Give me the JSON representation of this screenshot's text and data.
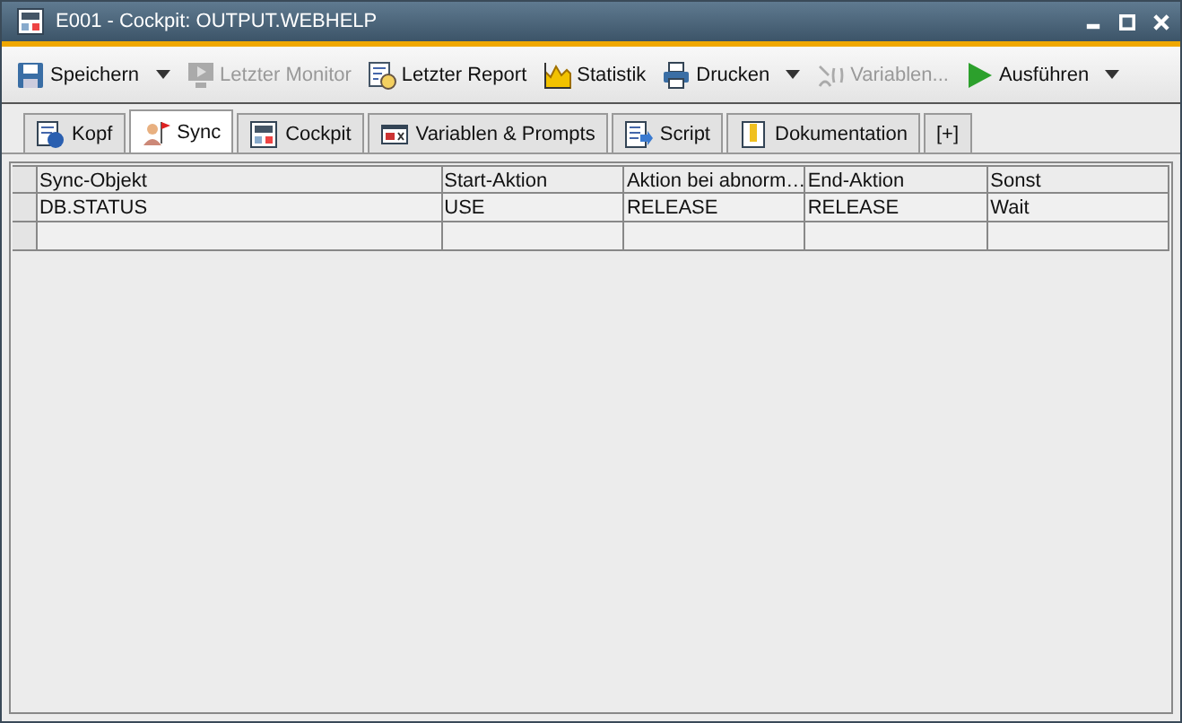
{
  "window": {
    "title": "E001 - Cockpit: OUTPUT.WEBHELP"
  },
  "toolbar": [
    {
      "label": "Speichern",
      "disabled": false,
      "dropdown": true
    },
    {
      "label": "Letzter Monitor",
      "disabled": true,
      "dropdown": false
    },
    {
      "label": "Letzter Report",
      "disabled": false,
      "dropdown": false
    },
    {
      "label": "Statistik",
      "disabled": false,
      "dropdown": false
    },
    {
      "label": "Drucken",
      "disabled": false,
      "dropdown": true
    },
    {
      "label": "Variablen...",
      "disabled": true,
      "dropdown": false
    },
    {
      "label": "Ausführen",
      "disabled": false,
      "dropdown": true
    }
  ],
  "tabs": [
    {
      "label": "Kopf",
      "selected": false
    },
    {
      "label": "Sync",
      "selected": true
    },
    {
      "label": "Cockpit",
      "selected": false
    },
    {
      "label": "Variablen & Prompts",
      "selected": false
    },
    {
      "label": "Script",
      "selected": false
    },
    {
      "label": "Dokumentation",
      "selected": false
    },
    {
      "label": "[+]",
      "selected": false
    }
  ],
  "table": {
    "columns": [
      "Sync-Objekt",
      "Start-Aktion",
      "Aktion bei abnorm…",
      "End-Aktion",
      "Sonst"
    ],
    "rows": [
      [
        "DB.STATUS",
        "USE",
        "RELEASE",
        "RELEASE",
        "Wait"
      ]
    ]
  }
}
